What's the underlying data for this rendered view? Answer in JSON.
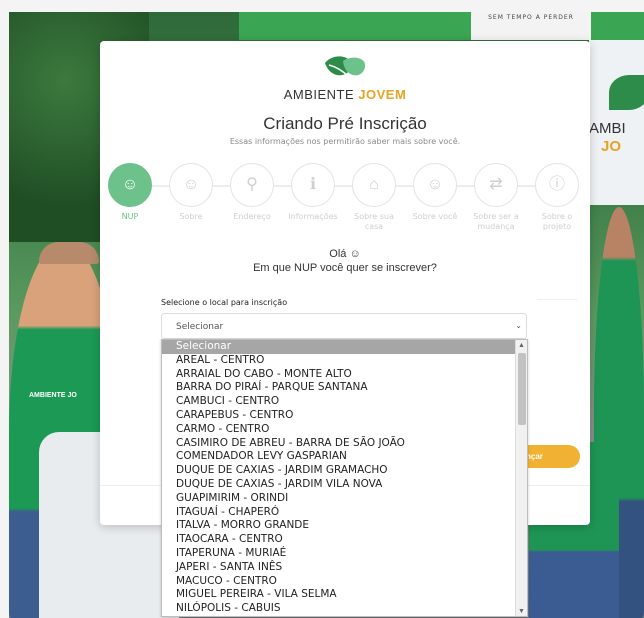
{
  "background": {
    "banner_text": "SEM TEMPO A PERDER",
    "right_panel_text_1": "AMBI",
    "right_panel_text_2": "JO",
    "shirt_logo": "AMBIENTE JO"
  },
  "brand": {
    "word_1": "AMBIENTE ",
    "word_2": "JOVEM",
    "color_green": "#2e8c4a",
    "color_accent": "#e7a322"
  },
  "header": {
    "title": "Criando Pré Inscrição",
    "subtitle": "Essas informações nos permitirão saber mais sobre você."
  },
  "steps": [
    {
      "label": "NUP",
      "icon": "palette-icon",
      "glyph": "☺",
      "active": true
    },
    {
      "label": "Sobre",
      "icon": "user-icon",
      "glyph": "☺",
      "active": false
    },
    {
      "label": "Endereço",
      "icon": "map-pin-icon",
      "glyph": "⚲",
      "active": false
    },
    {
      "label": "Informações",
      "icon": "info-icon",
      "glyph": "ℹ",
      "active": false
    },
    {
      "label": "Sobre sua casa",
      "icon": "home-icon",
      "glyph": "⌂",
      "active": false
    },
    {
      "label": "Sobre você",
      "icon": "smile-icon",
      "glyph": "☺",
      "active": false
    },
    {
      "label": "Sobre ser a mudança",
      "icon": "shuffle-icon",
      "glyph": "⇄",
      "active": false
    },
    {
      "label": "Sobre o projeto",
      "icon": "info-circle-icon",
      "glyph": "ⓘ",
      "active": false
    }
  ],
  "greeting": {
    "line1": "Olá ☺",
    "line2": "Em que NUP você quer se inscrever?"
  },
  "form": {
    "label": "Selecione o local para inscrição",
    "select_value": "Selecionar"
  },
  "advance_button": "nçar",
  "dropdown": {
    "options": [
      "Selecionar",
      "AREAL - CENTRO",
      "ARRAIAL DO CABO - MONTE ALTO",
      "BARRA DO PIRAÍ - PARQUE SANTANA",
      "CAMBUCI - CENTRO",
      "CARAPEBUS - CENTRO",
      "CARMO - CENTRO",
      "CASIMIRO DE ABREU - BARRA DE SÃO JOÃO",
      "COMENDADOR LEVY GASPARIAN",
      "DUQUE DE CAXIAS - JARDIM GRAMACHO",
      "DUQUE DE CAXIAS - JARDIM VILA NOVA",
      "GUAPIMIRIM - ORINDI",
      "ITAGUAÍ - CHAPERÓ",
      "ITALVA - MORRO GRANDE",
      "ITAOCARA - CENTRO",
      "ITAPERUNA - MURIAÉ",
      "JAPERI - SANTA INÊS",
      "MACUCO - CENTRO",
      "MIGUEL PEREIRA - VILA SELMA",
      "NILÓPOLIS - CABUIS"
    ],
    "selected_index": 0
  }
}
